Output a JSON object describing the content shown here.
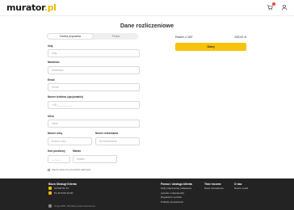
{
  "header": {
    "logo_main": "murator",
    "logo_tld": ".pl"
  },
  "page": {
    "title": "Dane rozliczeniowe"
  },
  "tabs": [
    {
      "label": "Osoba prywatna"
    },
    {
      "label": "Firma"
    }
  ],
  "form": {
    "first_name_label": "Imię",
    "first_name_placeholder": "Imię",
    "last_name_label": "Nazwisko",
    "last_name_placeholder": "Nazwisko",
    "email_label": "Email",
    "email_placeholder": "Email",
    "phone_label": "Numer telefonu (opcjonalnie)",
    "phone_placeholder": "+48 ___ ___ ___",
    "street_label": "Ulica",
    "street_placeholder": "Ulica",
    "house_label": "Numer ulicy",
    "house_placeholder": "Numer ulicy",
    "flat_label": "Numer mieszkania",
    "flat_placeholder": "Nr mieszkania",
    "postcode_label": "Kod pocztowy",
    "postcode_placeholder": "__-___",
    "city_label": "Miasto",
    "city_placeholder": "Miasto",
    "consent_text": "Zapisz dane do przyszłych płatności"
  },
  "summary": {
    "label": "Razem z VAT",
    "amount": "205,00 zł",
    "pay_label": "Dalej"
  },
  "footer": {
    "col1_head": "Biuro Obsługi Klienta",
    "col1_phone1": "22 590 51 51",
    "col1_hours": "Pn-Pt 8:00-16:00",
    "col2_head": "Pomoc i obsługa klienta",
    "col2_item1": "FAQ (najczęściej zadawane",
    "col2_item2": "pytania i odpowiedzi)",
    "col2_item3": "Regulamin serwisu",
    "col2_item4": "Polityka prywatności",
    "col3_head": "Time Income",
    "col3_item1": "Dane kontaktowe",
    "col4_head": "O nas",
    "col4_item1": "Nasze marki",
    "legal": "Grupa ZPR. Wszelkie prawa zastrzeżone"
  }
}
